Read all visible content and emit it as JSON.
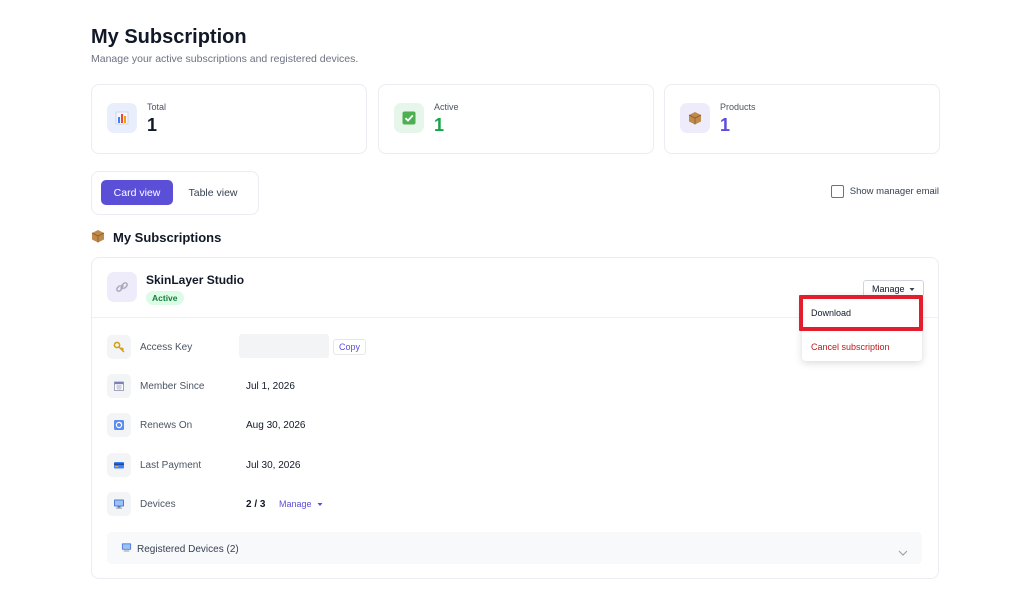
{
  "header": {
    "title": "My Subscription",
    "subtitle": "Manage your active subscriptions and registered devices."
  },
  "stats": [
    {
      "label": "Total",
      "value": "1",
      "icon": "bar-chart-icon",
      "color": "#111827"
    },
    {
      "label": "Active",
      "value": "1",
      "icon": "checkmark-icon",
      "color": "#16a34a"
    },
    {
      "label": "Products",
      "value": "1",
      "icon": "package-icon",
      "color": "#5b4fd8"
    }
  ],
  "view_toggle": {
    "card": "Card view",
    "table": "Table view",
    "active": "card"
  },
  "show_manager_email": {
    "label": "Show manager email",
    "checked": false
  },
  "section": {
    "title": "My Subscriptions",
    "icon": "package-icon"
  },
  "subscription": {
    "name": "SkinLayer Studio",
    "status": "Active",
    "manage_label": "Manage",
    "rows": {
      "access_key": {
        "label": "Access Key",
        "value": "",
        "copy_label": "Copy"
      },
      "member_since": {
        "label": "Member Since",
        "value": "Jul 1, 2026"
      },
      "renews_on": {
        "label": "Renews On",
        "value": "Aug 30, 2026"
      },
      "last_payment": {
        "label": "Last Payment",
        "value": "Jul 30, 2026"
      },
      "devices": {
        "label": "Devices",
        "value": "2 / 3",
        "manage_label": "Manage"
      }
    },
    "registered_devices": {
      "label": "Registered Devices (2)"
    }
  },
  "manage_menu": {
    "items": [
      "Download",
      "Cancel subscription"
    ],
    "highlighted": "Download"
  },
  "colors": {
    "accent": "#5b4fd8",
    "danger": "#b91c1c",
    "success": "#16a34a",
    "highlight": "#e11d2e"
  }
}
